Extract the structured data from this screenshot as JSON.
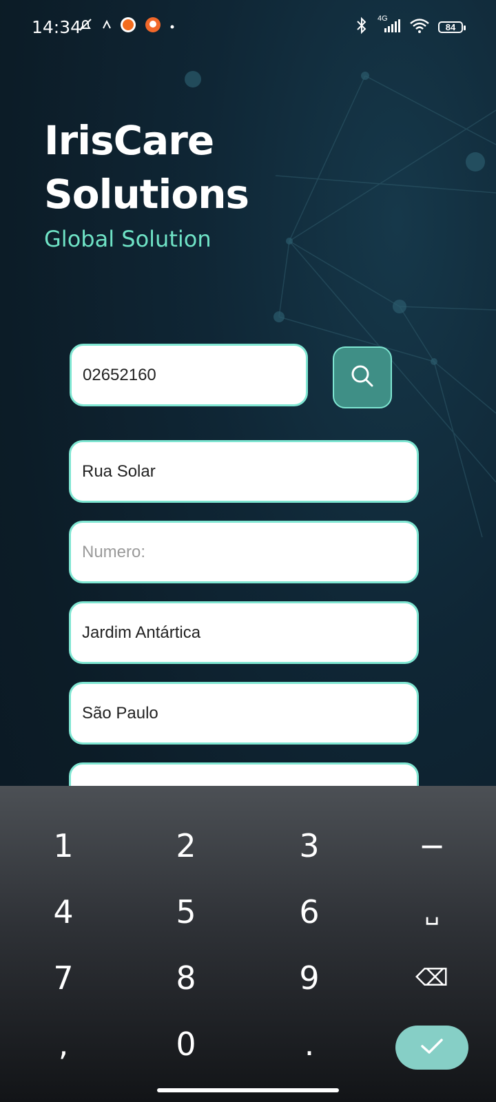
{
  "status_bar": {
    "time": "14:34",
    "network_label": "4G",
    "battery_level": "84"
  },
  "brand": {
    "title_line1": "IrisCare",
    "title_line2": "Solutions",
    "subtitle": "Global Solution"
  },
  "form": {
    "cep_value": "02652160",
    "street_value": "Rua Solar",
    "number_value": "",
    "number_placeholder": "Numero:",
    "neighborhood_value": "Jardim Antártica",
    "city_value": "São Paulo",
    "state_value": ""
  },
  "keyboard": {
    "keys": [
      "1",
      "2",
      "3",
      "−",
      "4",
      "5",
      "6",
      "␣",
      "7",
      "8",
      "9",
      "⌫",
      ",",
      "0",
      "."
    ]
  },
  "colors": {
    "accent": "#7fe6d2",
    "subtitle": "#6fe3c6",
    "search_button": "#3f8f86",
    "confirm_button": "#86cfc6"
  }
}
